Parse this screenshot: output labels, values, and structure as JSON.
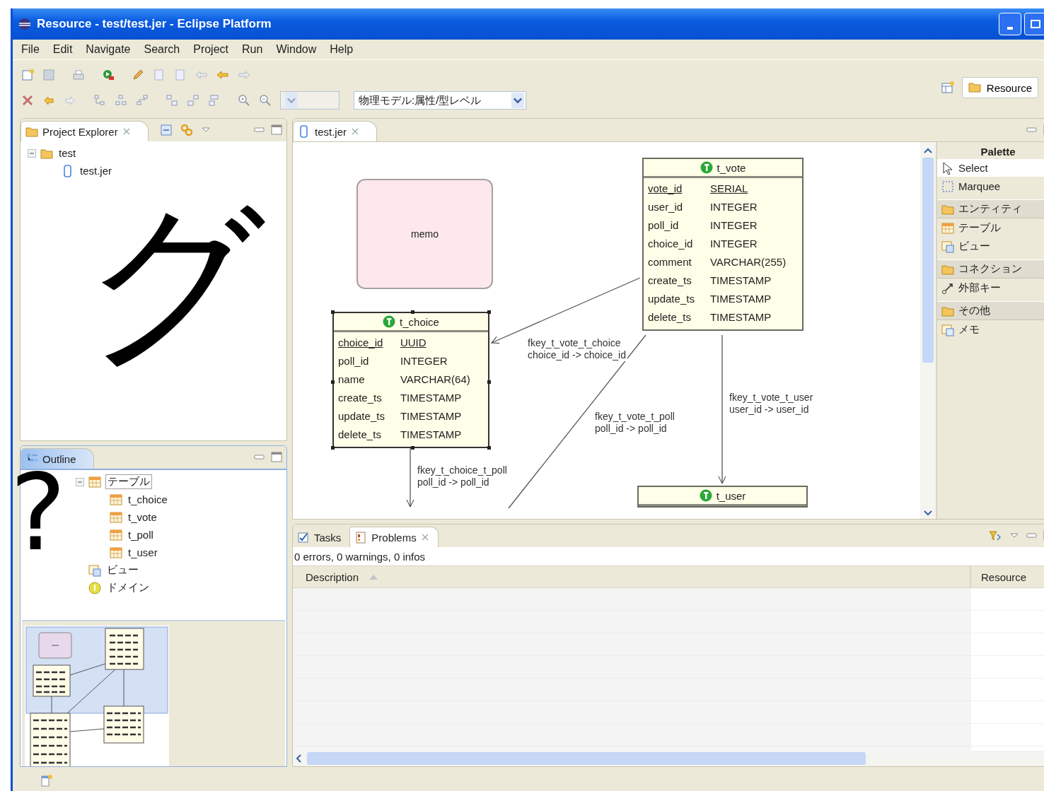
{
  "window": {
    "title": "Resource - test/test.jer - Eclipse Platform"
  },
  "menu": [
    "File",
    "Edit",
    "Navigate",
    "Search",
    "Project",
    "Run",
    "Window",
    "Help"
  ],
  "toolbar": {
    "zoom_combo": {
      "disabled": true
    },
    "view_combo": {
      "value": "物理モデル:属性/型レベル"
    }
  },
  "perspective": {
    "label": "Resource",
    "selected": true
  },
  "project_explorer": {
    "title": "Project Explorer",
    "tree": [
      {
        "label": "test",
        "kind": "project",
        "expanded": true,
        "children": [
          {
            "label": "test.jer",
            "kind": "file"
          }
        ]
      }
    ]
  },
  "outline": {
    "title": "Outline",
    "tree": [
      {
        "label": "テーブル",
        "kind": "table-group",
        "expanded": true,
        "selected": true,
        "children": [
          {
            "label": "t_choice",
            "kind": "table",
            "selected": false
          },
          {
            "label": "t_vote",
            "kind": "table",
            "selected": false
          },
          {
            "label": "t_poll",
            "kind": "table",
            "selected": false
          },
          {
            "label": "t_user",
            "kind": "table",
            "selected": false
          }
        ]
      },
      {
        "label": "ビュー",
        "kind": "view",
        "selected": false
      },
      {
        "label": "ドメイン",
        "kind": "domain",
        "selected": false
      }
    ]
  },
  "editor": {
    "tab": {
      "label": "test.jer"
    },
    "memo": {
      "text": "memo"
    },
    "tables": [
      {
        "name": "t_vote",
        "selected": false,
        "columns": [
          {
            "name": "vote_id",
            "type": "SERIAL",
            "primary": true
          },
          {
            "name": "user_id",
            "type": "INTEGER",
            "primary": false
          },
          {
            "name": "poll_id",
            "type": "INTEGER",
            "primary": false
          },
          {
            "name": "choice_id",
            "type": "INTEGER",
            "primary": false
          },
          {
            "name": "comment",
            "type": "VARCHAR(255)",
            "primary": false
          },
          {
            "name": "create_ts",
            "type": "TIMESTAMP",
            "primary": false
          },
          {
            "name": "update_ts",
            "type": "TIMESTAMP",
            "primary": false
          },
          {
            "name": "delete_ts",
            "type": "TIMESTAMP",
            "primary": false
          }
        ]
      },
      {
        "name": "t_choice",
        "selected": true,
        "columns": [
          {
            "name": "choice_id",
            "type": "UUID",
            "primary": true
          },
          {
            "name": "poll_id",
            "type": "INTEGER",
            "primary": false
          },
          {
            "name": "name",
            "type": "VARCHAR(64)",
            "primary": false
          },
          {
            "name": "create_ts",
            "type": "TIMESTAMP",
            "primary": false
          },
          {
            "name": "update_ts",
            "type": "TIMESTAMP",
            "primary": false
          },
          {
            "name": "delete_ts",
            "type": "TIMESTAMP",
            "primary": false
          }
        ]
      },
      {
        "name": "t_user",
        "selected": false
      }
    ],
    "relations": [
      {
        "name": "fkey_t_vote_t_choice",
        "mapping": "choice_id -> choice_id"
      },
      {
        "name": "fkey_t_vote_t_poll",
        "mapping": "poll_id -> poll_id"
      },
      {
        "name": "fkey_t_vote_t_user",
        "mapping": "user_id -> user_id"
      },
      {
        "name": "fkey_t_choice_t_poll",
        "mapping": "poll_id -> poll_id"
      }
    ]
  },
  "palette": {
    "title": "Palette",
    "items": [
      {
        "kind": "tool",
        "label": "Select",
        "selected": true
      },
      {
        "kind": "tool",
        "label": "Marquee",
        "selected": false
      },
      {
        "kind": "drawer",
        "label": "エンティティ"
      },
      {
        "kind": "tool",
        "label": "テーブル",
        "selected": false
      },
      {
        "kind": "tool",
        "label": "ビュー",
        "selected": false
      },
      {
        "kind": "drawer",
        "label": "コネクション"
      },
      {
        "kind": "tool",
        "label": "外部キー",
        "selected": false
      },
      {
        "kind": "drawer",
        "label": "その他"
      },
      {
        "kind": "tool",
        "label": "メモ",
        "selected": false
      }
    ]
  },
  "problems": {
    "tabs": [
      {
        "label": "Tasks",
        "selected": false
      },
      {
        "label": "Problems",
        "selected": true
      }
    ],
    "summary": "0 errors, 0 warnings, 0 infos",
    "columns": [
      {
        "label": "Description",
        "sorted": true
      },
      {
        "label": "Resource",
        "sorted": false
      }
    ]
  },
  "overlay": {
    "lines": [
      "グ",
      "?"
    ]
  }
}
